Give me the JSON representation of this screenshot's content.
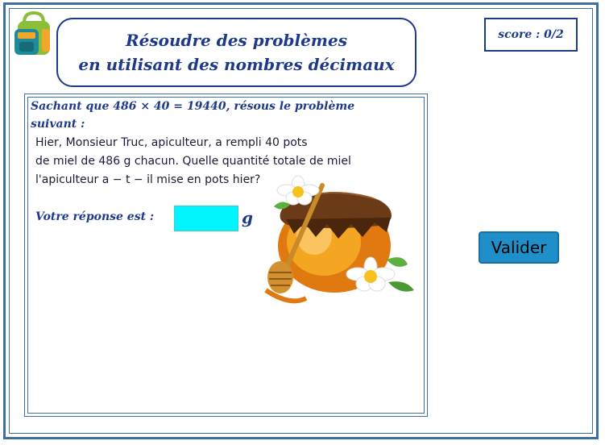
{
  "header": {
    "title_line1": "Résoudre des problèmes",
    "title_line2": "en utilisant des nombres décimaux",
    "score": "score : 0/2"
  },
  "problem": {
    "intro_line1": "Sachant que 486 × 40 = 19440, résous le problème",
    "intro_line2": "suivant :",
    "text_line1": "Hier, Monsieur Truc, apiculteur, a rempli 40 pots",
    "text_line2": "de miel de 486 g chacun. Quelle quantité totale de miel",
    "text_line3": "l'apiculteur a − t − il mise en pots hier?"
  },
  "answer": {
    "label": "Votre réponse est :",
    "value": "",
    "unit": "g"
  },
  "actions": {
    "submit_label": "Valider"
  },
  "colors": {
    "frame": "#3f6f9c",
    "title": "#1d3a8a",
    "input": "#00f5ff",
    "button": "#1e8fc8"
  },
  "icons": [
    "backpack-icon",
    "honey-jar-illustration"
  ]
}
